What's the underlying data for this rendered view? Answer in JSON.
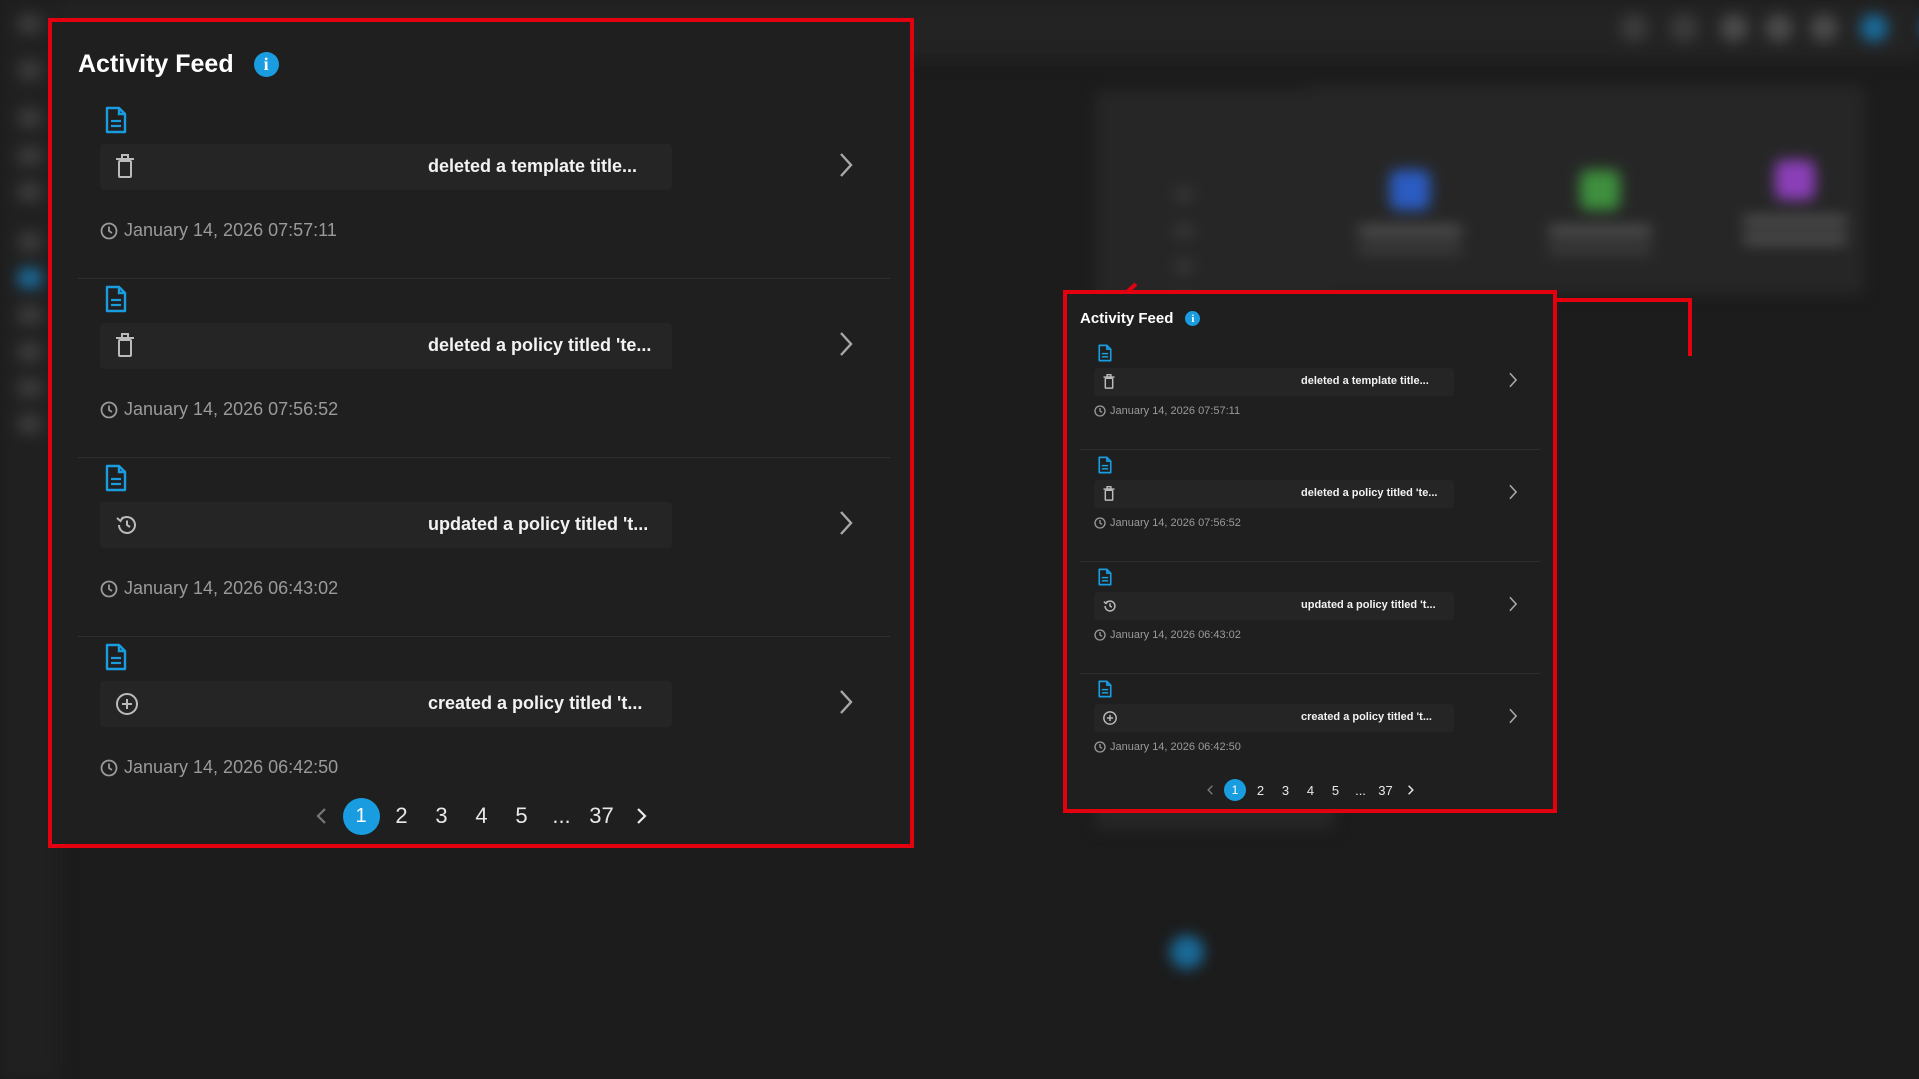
{
  "feed": {
    "title": "Activity Feed",
    "info_icon": "info-icon",
    "entries": [
      {
        "doc_icon": "document-icon",
        "action_icon": "trash-icon",
        "text": "deleted a template title...",
        "timestamp": "January 14, 2026 07:57:11"
      },
      {
        "doc_icon": "document-icon",
        "action_icon": "trash-icon",
        "text": "deleted a policy titled 'te...",
        "timestamp": "January 14, 2026 07:56:52"
      },
      {
        "doc_icon": "document-icon",
        "action_icon": "history-icon",
        "text": "updated a policy titled 't...",
        "timestamp": "January 14, 2026 06:43:02"
      },
      {
        "doc_icon": "document-icon",
        "action_icon": "plus-circle-icon",
        "text": "created a policy titled 't...",
        "timestamp": "January 14, 2026 06:42:50"
      }
    ],
    "pagination": {
      "current": "1",
      "pages": [
        "1",
        "2",
        "3",
        "4",
        "5",
        "...",
        "37"
      ]
    }
  },
  "colors": {
    "accent": "#1a9de0",
    "highlight_border": "#e3010f",
    "background": "#1c1c1c",
    "panel": "#1f1f1f"
  }
}
